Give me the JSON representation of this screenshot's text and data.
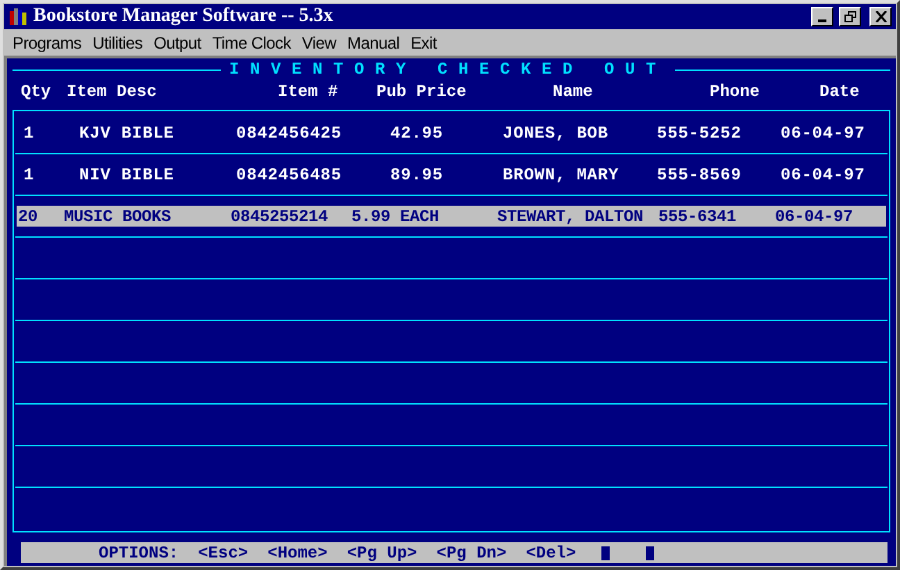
{
  "window": {
    "title": "Bookstore Manager Software -- 5.3x"
  },
  "menu": [
    "Programs",
    "Utilities",
    "Output",
    "Time Clock",
    "View",
    "Manual",
    "Exit"
  ],
  "heading": "INVENTORY CHECKED OUT",
  "columns": [
    "Qty",
    "Item Desc",
    "Item #",
    "Pub Price",
    "Name",
    "Phone",
    "Date"
  ],
  "rows": [
    {
      "selected": false,
      "cells": [
        "1",
        "KJV BIBLE",
        "0842456425",
        "42.95",
        "JONES, BOB",
        "555-5252",
        "06-04-97"
      ]
    },
    {
      "selected": false,
      "cells": [
        "1",
        "NIV BIBLE",
        "0842456485",
        "89.95",
        "BROWN, MARY",
        "555-8569",
        "06-04-97"
      ]
    },
    {
      "selected": true,
      "cells": [
        "20",
        "MUSIC BOOKS",
        "0845255214",
        "5.99 EACH",
        "STEWART, DALTON",
        "555-6341",
        "06-04-97"
      ]
    }
  ],
  "options": {
    "label": "OPTIONS:",
    "keys": [
      "<Esc>",
      "<Home>",
      "<Pg Up>",
      "<Pg Dn>",
      "<Del>"
    ]
  }
}
